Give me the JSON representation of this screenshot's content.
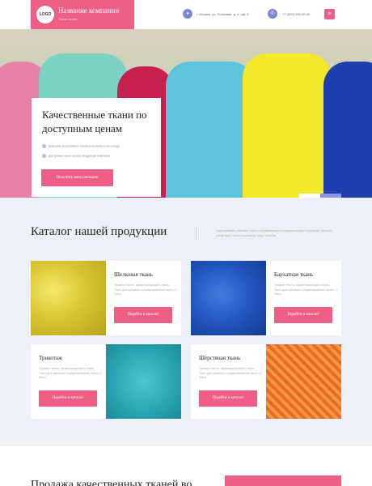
{
  "header": {
    "logo": "LOGO",
    "company_name": "Название компании",
    "tagline": "Ткани оптом",
    "address": "г. Москва, ул. Полковая, д. 4, оф. 5",
    "phone": "+7 (000) 000-00-00",
    "address_icon": "location-icon",
    "phone_icon": "phone-icon",
    "menu_icon": "menu-icon"
  },
  "hero": {
    "title": "Качественные ткани по доступным ценам",
    "points": [
      "Широкий ассортимент тканей в наличии и на складе",
      "Доступные цены на всю продукцию компании"
    ],
    "cta": "Получить консультацию",
    "prev_arrow": "‹",
    "next_arrow": "›"
  },
  "catalog": {
    "title": "Каталог нашей продукции",
    "description": "Наша компания работает только с проверенными производителями и предлагает широкий ассортимент тканей для любых задач и вкусов",
    "items": [
      {
        "title": "Шелковая ткань",
        "desc": "Пример текста, характеризующего ткань. Текст для примера и редактирования через CI Setra",
        "button": "Перейти в каталог"
      },
      {
        "title": "Бархатная ткань",
        "desc": "Пример текста, характеризующего ткань. Текст для примера и редактирования через CI Setra",
        "button": "Перейти в каталог"
      },
      {
        "title": "Трикотаж",
        "desc": "Пример текста, характеризующего ткань. Текст для примера и редактирования через CI Setra",
        "button": "Перейти в каталог"
      },
      {
        "title": "Шерстяная ткань",
        "desc": "Пример текста, характеризующего ткань. Текст для примера и редактирования через CI Setra",
        "button": "Перейти в каталог"
      }
    ]
  },
  "bottom": {
    "title": "Продажа качественных тканей во"
  },
  "colors": {
    "accent": "#ee5f88",
    "secondary": "#7b86d6",
    "background": "#eef0f7"
  }
}
